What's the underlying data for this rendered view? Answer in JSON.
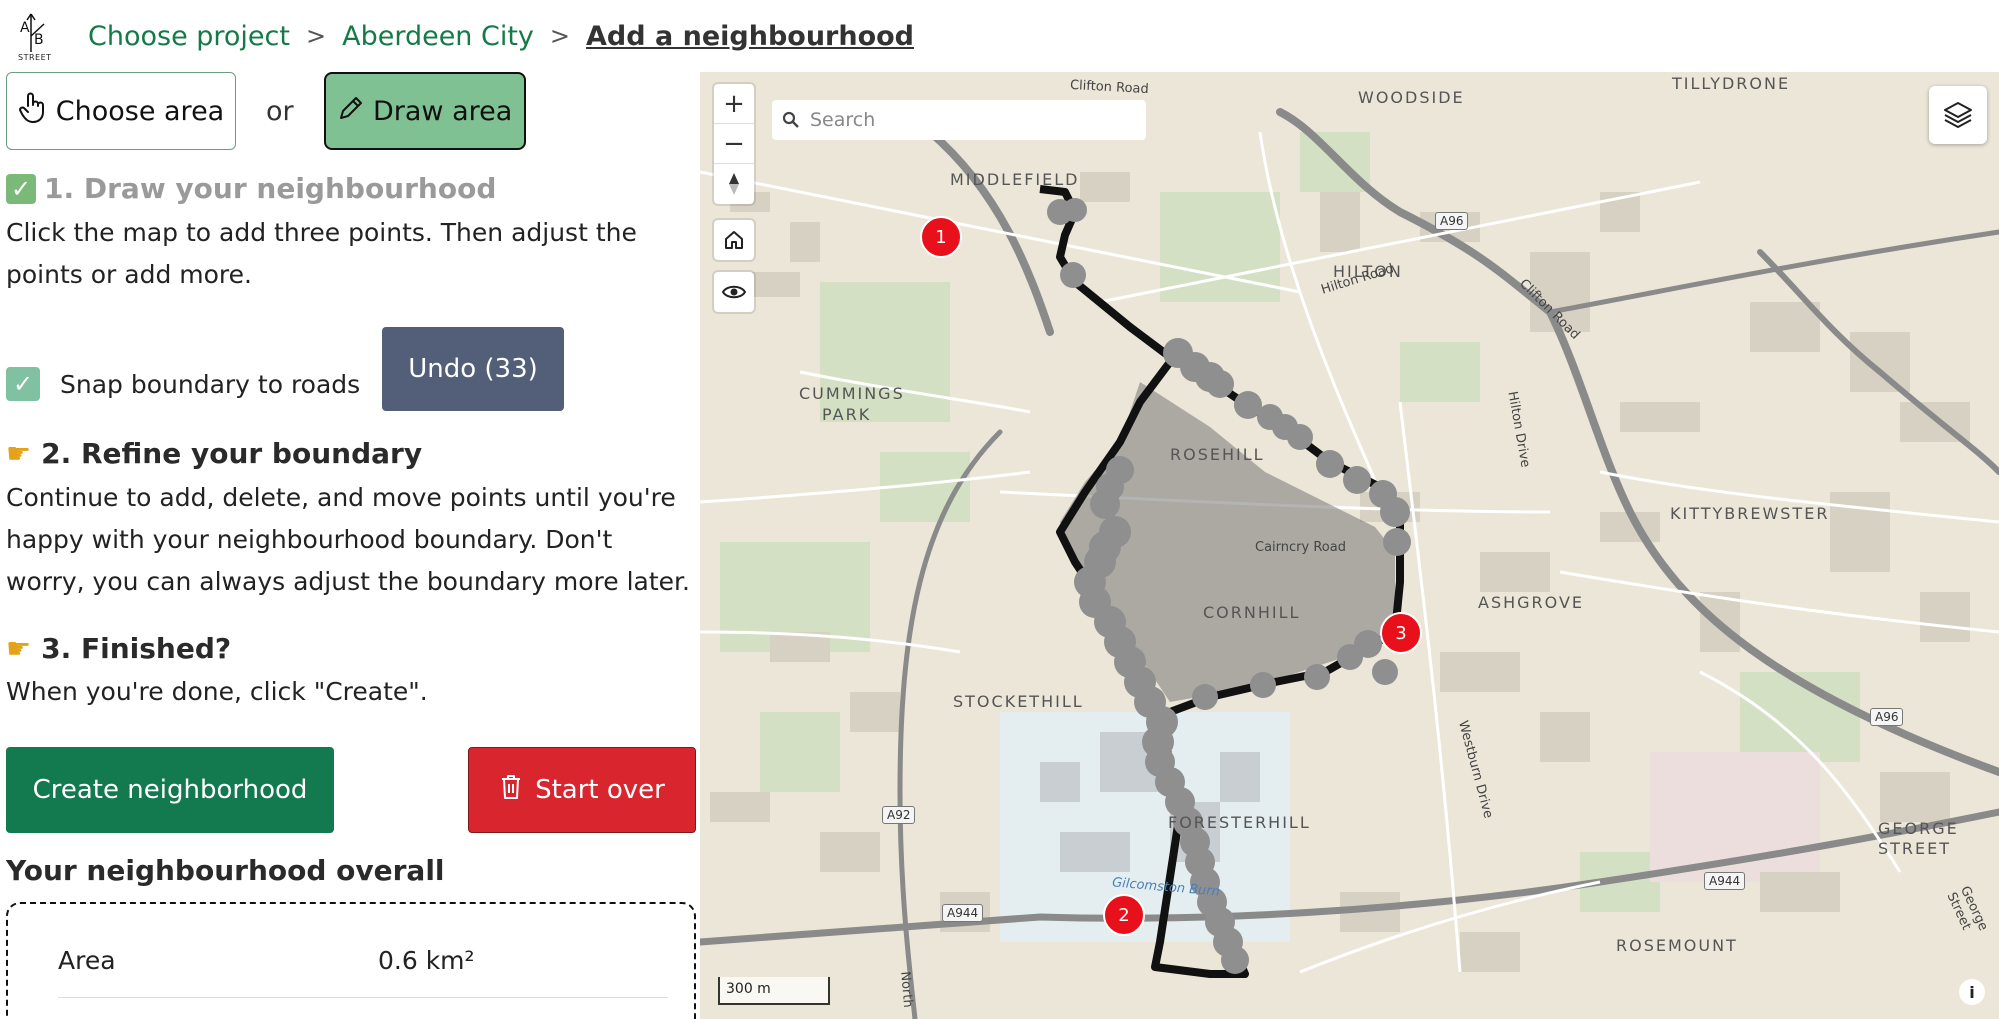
{
  "header": {
    "logo_text": "STREET",
    "crumbs": [
      "Choose project",
      "Aberdeen City"
    ],
    "separator": ">",
    "current": "Add a neighbourhood"
  },
  "mode": {
    "choose_label": "Choose area",
    "or_label": "or",
    "draw_label": "Draw area"
  },
  "steps": {
    "step1_title": "1. Draw your neighbourhood",
    "step1_desc": "Click the map to add three points. Then adjust the points or add more.",
    "snap_label": "Snap boundary to roads",
    "snap_checked": true,
    "undo_label": "Undo (33)",
    "step2_title": "2. Refine your boundary",
    "step2_desc": "Continue to add, delete, and move points until you're happy with your neighbourhood boundary. Don't worry, you can always adjust the boundary more later.",
    "step3_title": "3. Finished?",
    "step3_desc": "When you're done, click \"Create\"."
  },
  "actions": {
    "create_label": "Create neighborhood",
    "start_over_label": "Start over"
  },
  "overall": {
    "title": "Your neighbourhood overall",
    "area_label": "Area",
    "area_value": "0.6 km²"
  },
  "map": {
    "search_placeholder": "Search",
    "scale_label": "300 m",
    "places": [
      "WOODSIDE",
      "TILLYDRONE",
      "MIDDLEFIELD",
      "HILTON",
      "CUMMINGS",
      "PARK",
      "ROSEHILL",
      "KITTYBREWSTER",
      "ASHGROVE",
      "CORNHILL",
      "STOCKETHILL",
      "FORESTERHILL",
      "GEORGE",
      "STREET",
      "ROSEMOUNT"
    ],
    "roads": [
      "Clifton Road",
      "Hilton Road",
      "Clifton Road",
      "Hilton Drive",
      "Cairncry Road",
      "Westburn Drive",
      "Gilcomston Burn",
      "George Street",
      "North"
    ],
    "shields": [
      "A96",
      "A96",
      "A92",
      "A944",
      "A944"
    ],
    "markers": [
      "1",
      "2",
      "3"
    ]
  },
  "colors": {
    "green_accent": "#137a4f",
    "draw_green": "#7fc193",
    "undo_slate": "#535f78",
    "danger_red": "#d9262e",
    "marker_red": "#e8101a"
  }
}
